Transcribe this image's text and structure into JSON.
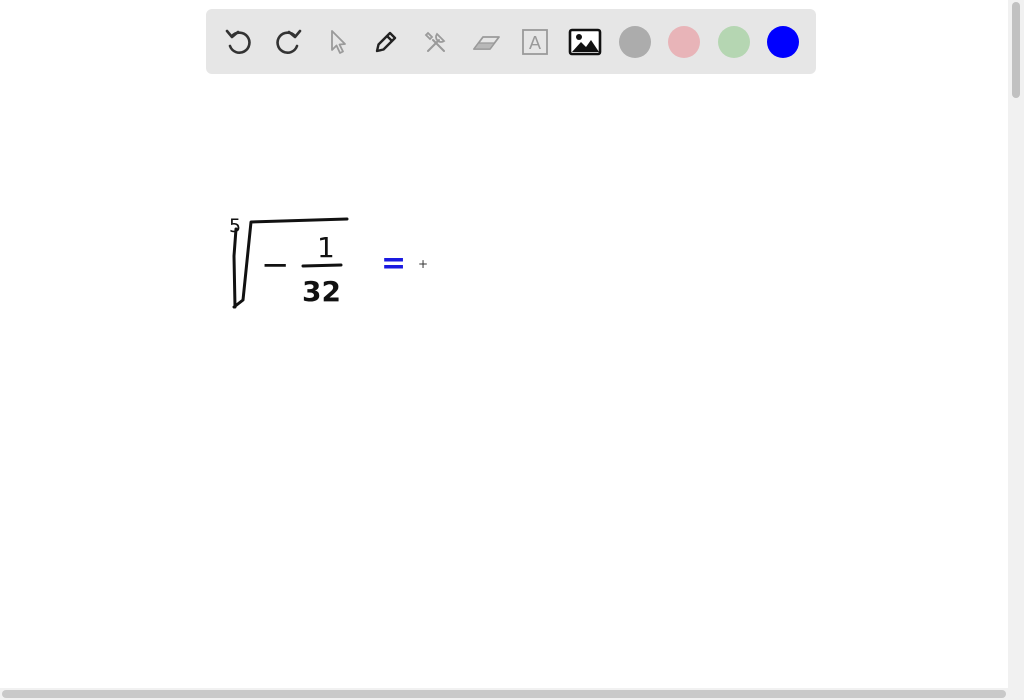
{
  "toolbar": {
    "tools": [
      {
        "name": "undo-icon",
        "enabled": true
      },
      {
        "name": "redo-icon",
        "enabled": true
      },
      {
        "name": "select-pointer-icon",
        "enabled": false
      },
      {
        "name": "pen-icon",
        "enabled": true
      },
      {
        "name": "tools-icon",
        "enabled": false
      },
      {
        "name": "eraser-icon",
        "enabled": false
      },
      {
        "name": "text-box-icon",
        "enabled": false
      },
      {
        "name": "image-icon",
        "enabled": true
      }
    ],
    "text_tool_glyph": "A",
    "colors": [
      {
        "name": "gray",
        "hex": "#acacac"
      },
      {
        "name": "pink",
        "hex": "#e8b4b8"
      },
      {
        "name": "green",
        "hex": "#b5d6b2"
      },
      {
        "name": "blue",
        "hex": "#0000ff"
      }
    ],
    "selected_color": "blue"
  },
  "canvas": {
    "ink_colors": {
      "black": "#111111",
      "blue": "#1a1ae0"
    },
    "handwritten": {
      "root_index": "5",
      "minus_sign": "−",
      "numerator": "1",
      "denominator": "32",
      "equals": "="
    },
    "cursor_glyph": "+"
  }
}
